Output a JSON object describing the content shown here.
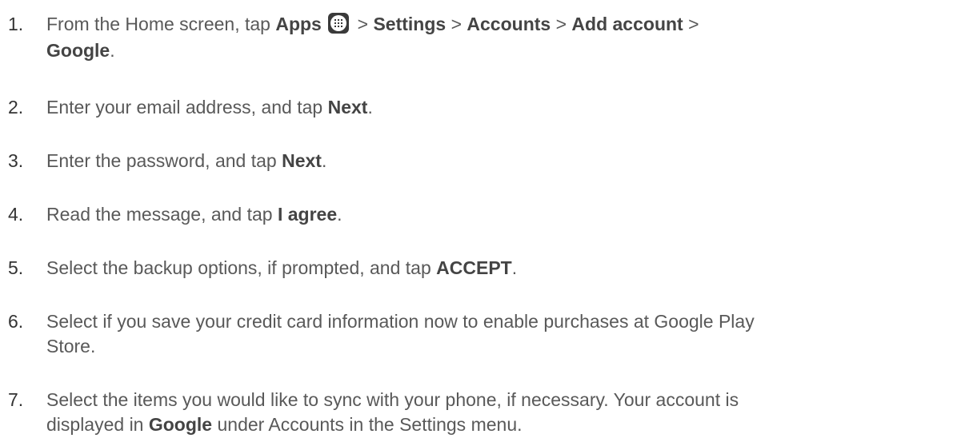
{
  "steps": [
    {
      "number": "1.",
      "parts": {
        "t1": "From the Home screen, tap ",
        "b1": "Apps",
        "t2": " > ",
        "b2": "Settings",
        "t3": " > ",
        "b3": "Accounts",
        "t4": " > ",
        "b4": "Add account",
        "t5": " >",
        "b5": "Google",
        "t6": "."
      },
      "icon": "apps-grid-icon"
    },
    {
      "number": "2.",
      "parts": {
        "t1": "Enter your email address, and tap ",
        "b1": "Next",
        "t2": "."
      }
    },
    {
      "number": "3.",
      "parts": {
        "t1": "Enter the password, and tap ",
        "b1": "Next",
        "t2": "."
      }
    },
    {
      "number": "4.",
      "parts": {
        "t1": "Read the message, and tap ",
        "b1": "I agree",
        "t2": "."
      }
    },
    {
      "number": "5.",
      "parts": {
        "t1": "Select the backup options, if prompted, and tap ",
        "b1": "ACCEPT",
        "t2": "."
      }
    },
    {
      "number": "6.",
      "parts": {
        "line1": "Select if you save your credit card information now to enable purchases at Google Play",
        "line2": "Store."
      }
    },
    {
      "number": "7.",
      "parts": {
        "line1": "Select the items you would like to sync with your phone, if necessary. Your account is",
        "t1": "displayed in ",
        "b1": "Google",
        "t2": " under Accounts in the Settings menu."
      }
    }
  ],
  "colors": {
    "text": "#595959",
    "bold": "#444444",
    "number": "#333333",
    "icon": "#3a3a3a"
  }
}
